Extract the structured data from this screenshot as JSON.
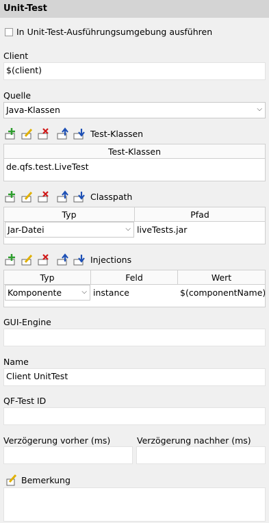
{
  "panel": {
    "title": "Unit-Test"
  },
  "checkbox": {
    "label": "In Unit-Test-Ausführungsumgebung ausführen",
    "checked": false
  },
  "client": {
    "label": "Client",
    "value": "$(client)"
  },
  "source": {
    "label": "Quelle",
    "value": "Java-Klassen"
  },
  "test_classes": {
    "title": "Test-Klassen",
    "columns": [
      "Test-Klassen"
    ],
    "rows": [
      [
        "de.qfs.test.LiveTest"
      ]
    ]
  },
  "classpath": {
    "title": "Classpath",
    "columns": [
      "Typ",
      "Pfad"
    ],
    "rows": [
      [
        "Jar-Datei",
        "liveTests.jar"
      ]
    ]
  },
  "injections": {
    "title": "Injections",
    "columns": [
      "Typ",
      "Feld",
      "Wert"
    ],
    "rows": [
      [
        "Komponente",
        "instance",
        "$(componentName)"
      ]
    ]
  },
  "gui_engine": {
    "label": "GUI-Engine",
    "value": ""
  },
  "name": {
    "label": "Name",
    "value": "Client UnitTest"
  },
  "qftest_id": {
    "label": "QF-Test ID",
    "value": ""
  },
  "delay_before": {
    "label": "Verzögerung vorher (ms)",
    "value": ""
  },
  "delay_after": {
    "label": "Verzögerung nachher (ms)",
    "value": ""
  },
  "comment": {
    "label": "Bemerkung",
    "value": ""
  },
  "toolbar_icons": [
    "add-icon",
    "edit-icon",
    "delete-icon",
    "move-up-icon",
    "move-down-icon"
  ],
  "colors": {
    "add": "#2e9e2e",
    "edit": "#e0b000",
    "delete": "#d01818",
    "move": "#1c4fb5",
    "header_bg": "#d4d4d4"
  }
}
